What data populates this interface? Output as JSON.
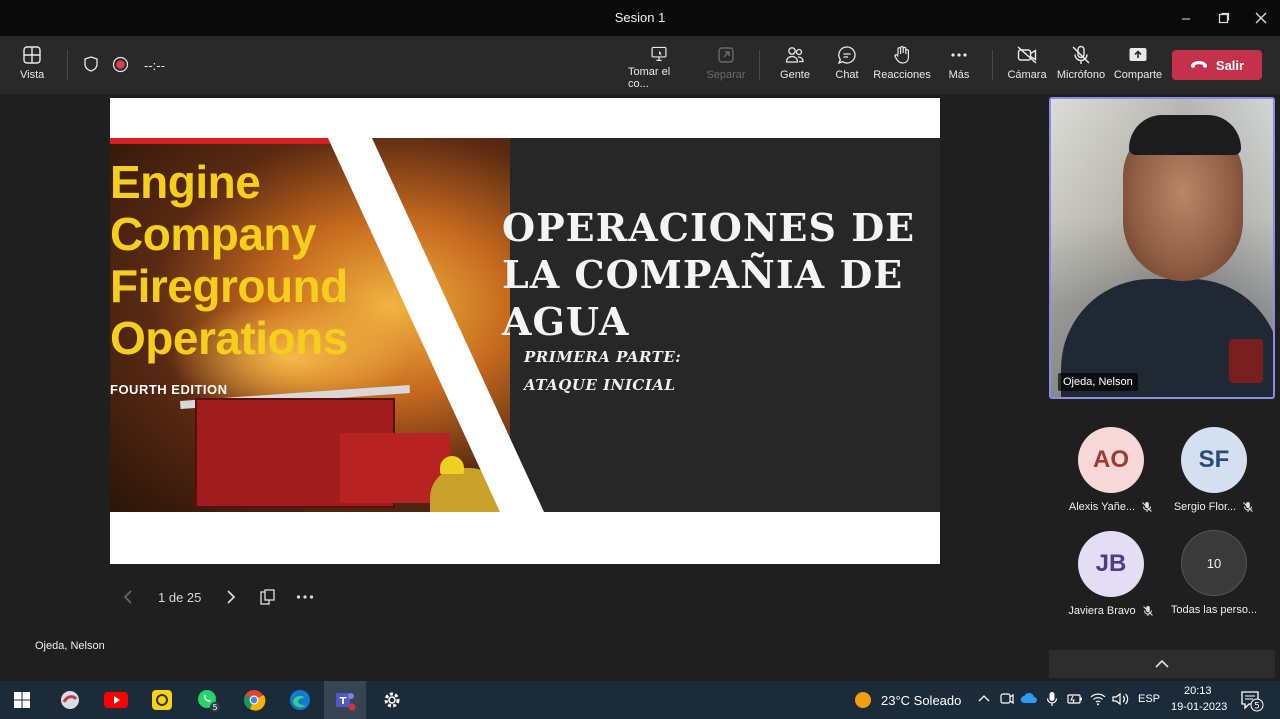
{
  "window": {
    "title": "Sesion 1"
  },
  "toolbar": {
    "view_label": "Vista",
    "timer": "--:--",
    "take_control_label": "Tomar el co...",
    "detach_label": "Separar",
    "people_label": "Gente",
    "chat_label": "Chat",
    "reactions_label": "Reacciones",
    "more_label": "Más",
    "camera_label": "Cámara",
    "mic_label": "Micrófono",
    "share_label": "Comparte",
    "leave_label": "Salir"
  },
  "slide": {
    "book_title": [
      "Engine",
      "Company",
      "Fireground",
      "Operations"
    ],
    "book_edition": "FOURTH EDITION",
    "title_lines": [
      "OPERACIONES DE",
      "LA COMPAÑIA DE",
      "AGUA"
    ],
    "subtitle_lines": [
      "PRIMERA PARTE:",
      "ATAQUE INICIAL"
    ]
  },
  "slide_nav": {
    "page": "1 de 25"
  },
  "presenter": {
    "name": "Ojeda, Nelson"
  },
  "video": {
    "name": "Ojeda, Nelson"
  },
  "participants": [
    {
      "initials": "AO",
      "name": "Alexis Yañe...",
      "avatar_bg": "#f6d8d6",
      "avatar_fg": "#9c3b34"
    },
    {
      "initials": "SF",
      "name": "Sergio Flor...",
      "avatar_bg": "#d4dff0",
      "avatar_fg": "#274b7a"
    },
    {
      "initials": "JB",
      "name": "Javiera Bravo",
      "avatar_bg": "#e3def3",
      "avatar_fg": "#4b3d86"
    }
  ],
  "others": {
    "count": "10",
    "label": "Todas las perso..."
  },
  "taskbar": {
    "whatsapp_badge": "5",
    "weather": "23°C  Soleado",
    "lang": "ESP",
    "time": "20:13",
    "date": "19-01-2023",
    "notifications": "5"
  },
  "colors": {
    "accent": "#8b8ce8",
    "leave": "#c4314b",
    "book_title": "#f5cf1c"
  }
}
